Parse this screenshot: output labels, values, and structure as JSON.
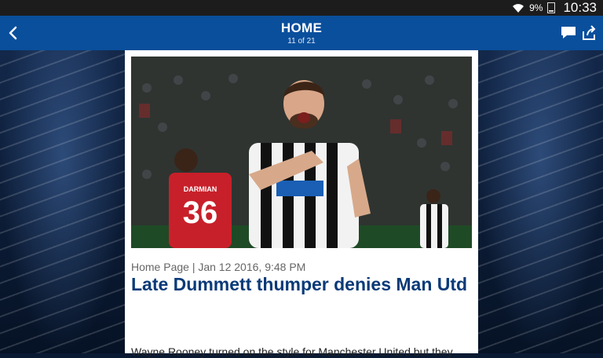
{
  "status_bar": {
    "battery_percent": "9%",
    "time": "10:33"
  },
  "header": {
    "title": "HOME",
    "subtitle": "11 of 21"
  },
  "article": {
    "meta": "Home Page | Jan 12 2016, 9:48 PM",
    "headline": "Late Dummett thumper denies Man Utd",
    "body_preview": "Wayne Rooney turned on the style for Manchester United but they",
    "jersey_name": "DARMIAN",
    "jersey_number": "36"
  },
  "icons": {
    "back": "back-chevron-icon",
    "comment": "comment-icon",
    "share": "share-icon",
    "wifi": "wifi-icon",
    "battery": "battery-icon"
  },
  "colors": {
    "header_bg": "#0a4f9c",
    "headline": "#0a3a78",
    "status_bar": "#1c1c1c"
  }
}
